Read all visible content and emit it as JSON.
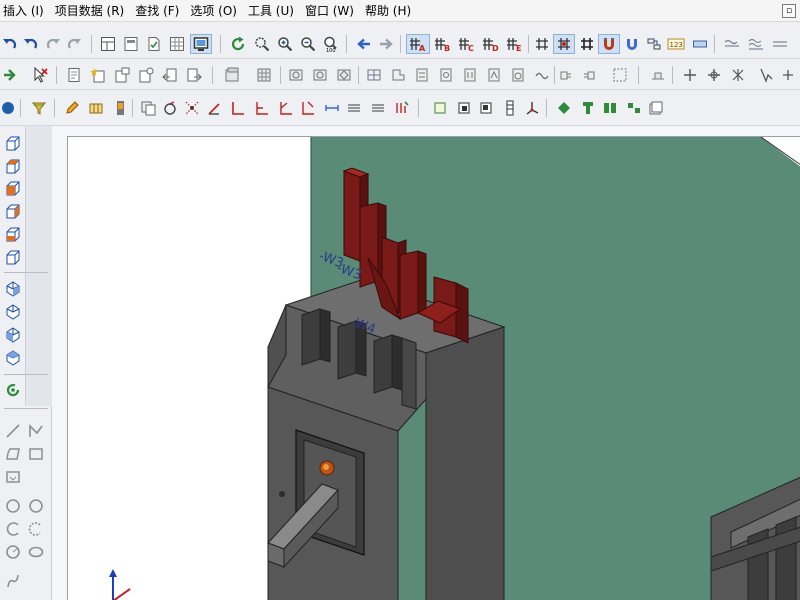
{
  "menu": {
    "items": [
      {
        "label": "插入 (I)"
      },
      {
        "label": "项目数据 (R)"
      },
      {
        "label": "查找 (F)"
      },
      {
        "label": "选项 (O)"
      },
      {
        "label": "工具 (U)"
      },
      {
        "label": "窗口 (W)"
      },
      {
        "label": "帮助 (H)"
      }
    ],
    "restore_glyph": "▫"
  },
  "toolbar1": {
    "buttons": [
      {
        "icon": "undo-icon"
      },
      {
        "icon": "undo-icon"
      },
      {
        "icon": "redo-icon"
      },
      {
        "icon": "redo-icon"
      },
      {
        "icon": "redo-icon"
      },
      {
        "icon": "layout-icon"
      },
      {
        "icon": "page-icon"
      },
      {
        "icon": "check-page-icon"
      },
      {
        "icon": "grid-table-icon"
      },
      {
        "icon": "monitor-icon"
      },
      {
        "icon": "refresh-icon"
      },
      {
        "icon": "zoom-window-icon"
      },
      {
        "icon": "zoom-in-icon"
      },
      {
        "icon": "zoom-out-icon"
      },
      {
        "icon": "zoom-100-icon"
      },
      {
        "icon": "back-arrow-icon"
      },
      {
        "icon": "forward-arrow-icon"
      },
      {
        "icon": "grid-a-icon"
      },
      {
        "icon": "grid-b-icon"
      },
      {
        "icon": "grid-c-icon"
      },
      {
        "icon": "grid-d-icon"
      },
      {
        "icon": "grid-e-icon"
      },
      {
        "icon": "grid-icon"
      },
      {
        "icon": "snap-grid-icon"
      },
      {
        "icon": "ortho-icon"
      },
      {
        "icon": "magnet-icon"
      },
      {
        "icon": "magnet-2-icon"
      },
      {
        "icon": "connect-icon"
      },
      {
        "icon": "number-icon"
      },
      {
        "icon": "rect-icon"
      },
      {
        "icon": "wave-icon"
      },
      {
        "icon": "wave-2-icon"
      },
      {
        "icon": "wave-3-icon"
      }
    ],
    "grid_letters": [
      "A",
      "B",
      "C",
      "D",
      "E"
    ],
    "zoom_label": "100",
    "number_label": "123"
  },
  "canvas": {
    "wire_labels": [
      "-W3",
      "-W3",
      "-W4"
    ]
  }
}
